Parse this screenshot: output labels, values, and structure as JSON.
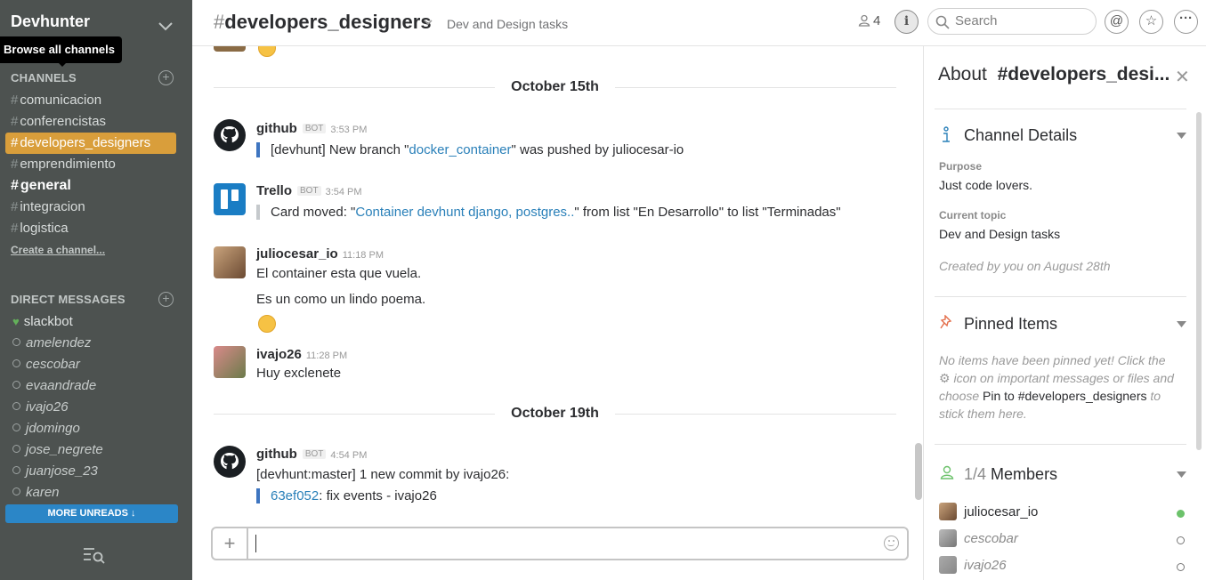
{
  "team": {
    "name": "Devhunter",
    "tooltip": "Browse all channels"
  },
  "sidebar": {
    "channels_title": "CHANNELS",
    "channels": [
      {
        "hash": "#",
        "name": "comunicacion"
      },
      {
        "hash": "#",
        "name": "conferencistas"
      },
      {
        "hash": "#",
        "name": "developers_designers"
      },
      {
        "hash": "#",
        "name": "emprendimiento"
      },
      {
        "hash": "#",
        "name": "general"
      },
      {
        "hash": "#",
        "name": "integracion"
      },
      {
        "hash": "#",
        "name": "logistica"
      }
    ],
    "create_channel": "Create a channel...",
    "dm_title": "DIRECT MESSAGES",
    "dms": [
      "slackbot",
      "amelendez",
      "cescobar",
      "evaandrade",
      "ivajo26",
      "jdomingo",
      "jose_negrete",
      "juanjose_23",
      "karen"
    ],
    "more_unreads": "MORE UNREADS"
  },
  "header": {
    "hash": "#",
    "channel": "developers_designers",
    "topic": "Dev and Design tasks",
    "member_count": "4",
    "search_placeholder": "Search"
  },
  "messages": {
    "day1": "October 15th",
    "m1": {
      "user": "github",
      "bot": "BOT",
      "time": "3:53 PM",
      "pre": "[devhunt] New branch \"",
      "link": "docker_container",
      "post": "\" was pushed by juliocesar-io"
    },
    "m2": {
      "user": "Trello",
      "bot": "BOT",
      "time": "3:54 PM",
      "pre": "Card moved: \"",
      "link": "Container devhunt django, postgres..",
      "post": "\" from list \"En Desarrollo\" to list \"Terminadas\""
    },
    "m3": {
      "user": "juliocesar_io",
      "time": "11:18 PM",
      "line1": "El container esta que vuela.",
      "line2": "Es un como un lindo poema."
    },
    "m4": {
      "user": "ivajo26",
      "time": "11:28 PM",
      "line1": "Huy exclenete"
    },
    "day2": "October 19th",
    "m5": {
      "user": "github",
      "bot": "BOT",
      "time": "4:54 PM",
      "line1": "[devhunt:master] 1 new commit by ivajo26:",
      "link": "63ef052",
      "post": ": fix events - ivajo26"
    }
  },
  "panel": {
    "about": "About",
    "channel_trunc": "#developers_desi...",
    "details_title": "Channel Details",
    "purpose_label": "Purpose",
    "purpose": "Just code lovers.",
    "topic_label": "Current topic",
    "topic": "Dev and Design tasks",
    "created": "Created by you on August 28th",
    "pinned_title": "Pinned Items",
    "pinned_1": "No items have been pinned yet! Click the",
    "pinned_2": "icon on important messages or files and",
    "pinned_3": "choose",
    "pinned_em": "Pin to #developers_designers",
    "pinned_4": "to stick them here.",
    "members_count": "1/4",
    "members_title": "Members",
    "members": [
      "juliocesar_io",
      "cescobar",
      "ivajo26"
    ]
  }
}
